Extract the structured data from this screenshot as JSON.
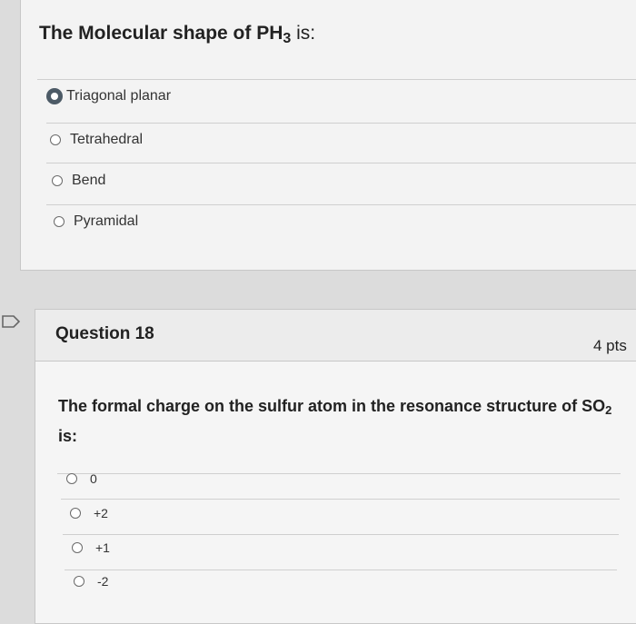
{
  "question1": {
    "title_prefix": "The Molecular shape of PH",
    "title_sub": "3",
    "title_suffix": " is:",
    "options": [
      "Triagonal planar",
      "Tetrahedral",
      "Bend",
      "Pyramidal"
    ]
  },
  "question2": {
    "name": "Question 18",
    "points": "4 pts",
    "text_main": "The formal charge on the sulfur atom in the resonance structure of SO",
    "text_sub": "2",
    "text_suffix": " is:",
    "options": [
      "0",
      "+2",
      "+1",
      "-2"
    ]
  }
}
